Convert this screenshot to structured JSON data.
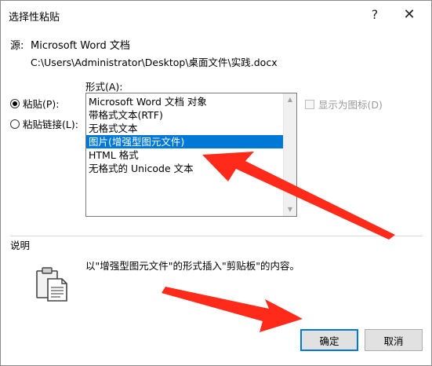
{
  "dialog": {
    "title": "选择性粘贴",
    "help_label": "?",
    "close_label": "✕"
  },
  "source": {
    "label": "源:",
    "name": "Microsoft Word 文档",
    "path": "C:\\Users\\Administrator\\Desktop\\桌面文件\\实践.docx"
  },
  "paste_options": {
    "paste_label": "粘贴(P):",
    "paste_link_label": "粘贴链接(L):",
    "selected": "paste"
  },
  "format": {
    "label": "形式(A):",
    "items": [
      "Microsoft Word 文档 对象",
      "带格式文本(RTF)",
      "无格式文本",
      "图片(增强型图元文件)",
      "HTML 格式",
      "无格式的 Unicode 文本"
    ],
    "selected_index": 3
  },
  "display_as_icon": {
    "label": "显示为图标(D)",
    "checked": false,
    "enabled": false
  },
  "description": {
    "label": "说明",
    "text": "以\"增强型图元文件\"的形式插入\"剪贴板\"的内容。",
    "icon": "clipboard-icon"
  },
  "buttons": {
    "ok_label": "确定",
    "cancel_label": "取消"
  },
  "colors": {
    "selection": "#0078d7",
    "arrow": "#ff2a1a"
  }
}
